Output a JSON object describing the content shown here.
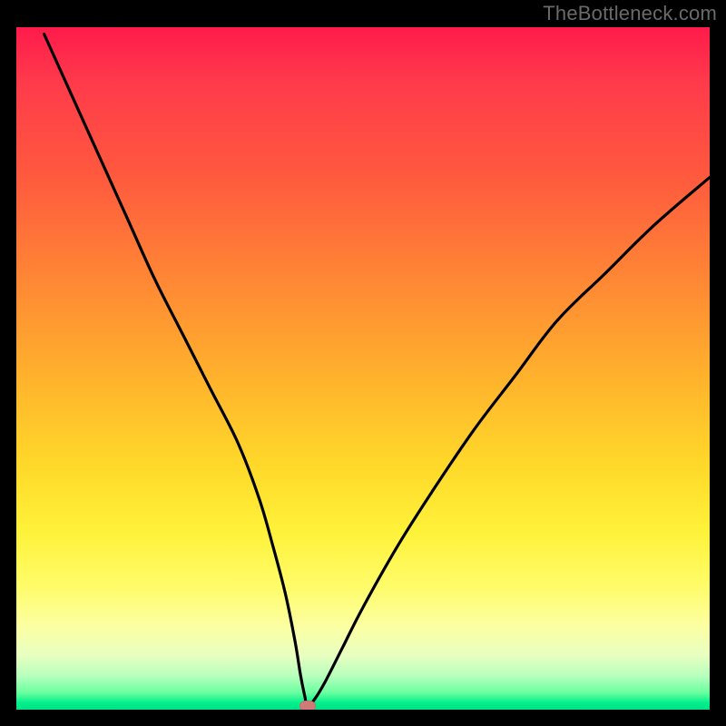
{
  "watermark": {
    "text": "TheBottleneck.com"
  },
  "colors": {
    "curve_stroke": "#000000",
    "marker_fill": "#cf7a77",
    "background": "#000000"
  },
  "chart_data": {
    "type": "line",
    "title": "",
    "xlabel": "",
    "ylabel": "",
    "xlim": [
      0,
      100
    ],
    "ylim": [
      0,
      100
    ],
    "grid": false,
    "legend": false,
    "series": [
      {
        "name": "bottleneck-curve",
        "x": [
          4,
          8,
          12,
          16,
          20,
          24,
          28,
          32,
          35,
          37,
          38.8,
          40.2,
          41.0,
          41.6,
          42.0,
          43.0,
          44.5,
          47,
          50,
          55,
          60,
          66,
          72,
          78,
          85,
          92,
          100
        ],
        "values": [
          99,
          90,
          81,
          72,
          63,
          55,
          47,
          39,
          31,
          24,
          17,
          10,
          5,
          2,
          0.5,
          1.5,
          4,
          9,
          15,
          24,
          32,
          41,
          49,
          57,
          64,
          71,
          78
        ]
      }
    ],
    "marker": {
      "x": 42.0,
      "y": 0.5
    }
  }
}
